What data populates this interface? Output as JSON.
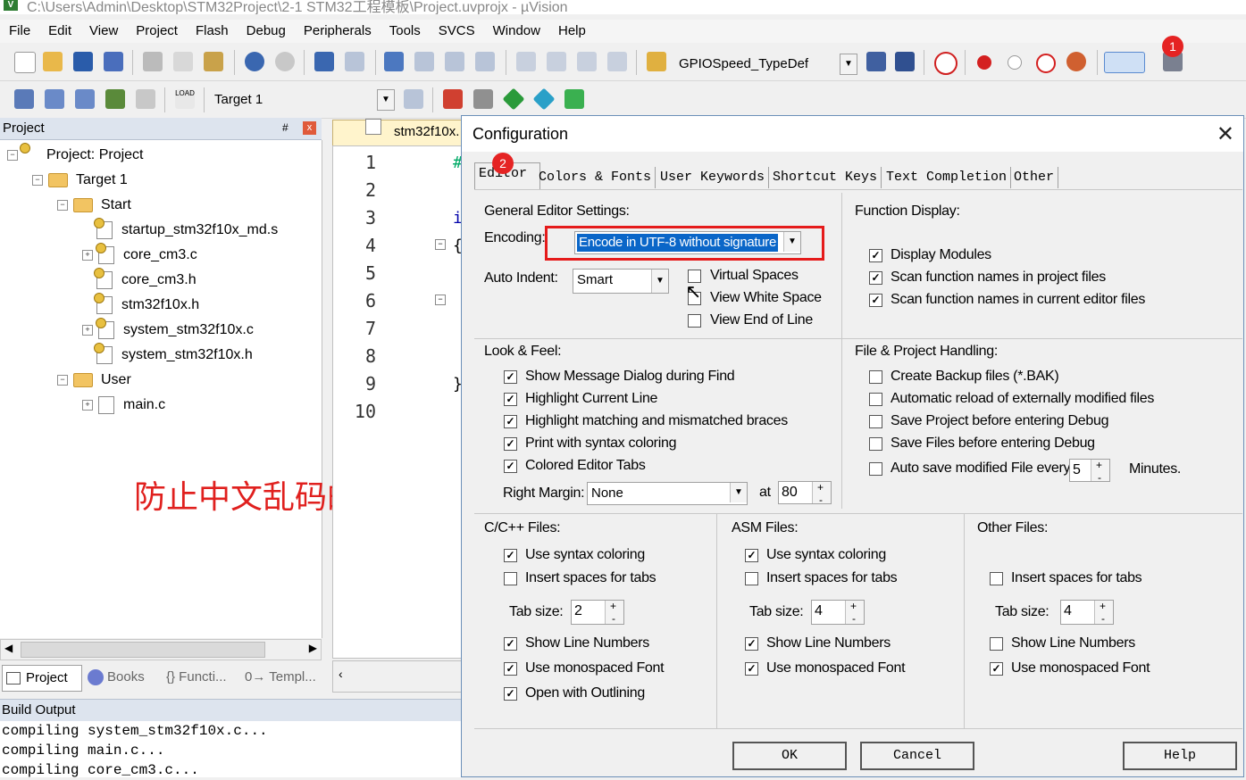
{
  "window": {
    "title": "C:\\Users\\Admin\\Desktop\\STM32Project\\2-1 STM32工程模板\\Project.uvprojx - µVision"
  },
  "menu": [
    "File",
    "Edit",
    "View",
    "Project",
    "Flash",
    "Debug",
    "Peripherals",
    "Tools",
    "SVCS",
    "Window",
    "Help"
  ],
  "toolbar1": {
    "symbol_combo": "GPIOSpeed_TypeDef"
  },
  "toolbar2": {
    "target_combo": "Target 1",
    "load_label": "LOAD"
  },
  "project_panel": {
    "title": "Project",
    "pin": "#",
    "close": "x",
    "tree": [
      {
        "label": "Project: Project"
      },
      {
        "label": "Target 1"
      },
      {
        "label": "Start"
      },
      {
        "label": "startup_stm32f10x_md.s"
      },
      {
        "label": "core_cm3.c"
      },
      {
        "label": "core_cm3.h"
      },
      {
        "label": "stm32f10x.h"
      },
      {
        "label": "system_stm32f10x.c"
      },
      {
        "label": "system_stm32f10x.h"
      },
      {
        "label": "User"
      },
      {
        "label": "main.c"
      }
    ],
    "tabs": [
      "Project",
      "Books",
      "{} Functi...",
      "0→ Templ..."
    ]
  },
  "editor": {
    "tab": "stm32f10x.",
    "line_numbers": [
      "1",
      "2",
      "3",
      "4",
      "5",
      "6",
      "7",
      "8",
      "9",
      "10"
    ],
    "code_chars": {
      "l1": "#",
      "l3": "i",
      "l4": "{",
      "l9": "}"
    }
  },
  "annotation": {
    "text": "防止中文乱码的问题"
  },
  "build_output": {
    "title": "Build Output",
    "lines": [
      "compiling system_stm32f10x.c...",
      "compiling main.c...",
      "compiling core_cm3.c..."
    ]
  },
  "dialog": {
    "title": "Configuration",
    "close": "✕",
    "tabs": [
      "Editor",
      "Colors & Fonts",
      "User Keywords",
      "Shortcut Keys",
      "Text Completion",
      "Other"
    ],
    "general": {
      "heading": "General Editor Settings:",
      "encoding_label": "Encoding:",
      "encoding_value": "Encode in UTF-8 without signature",
      "auto_indent_label": "Auto Indent:",
      "auto_indent_value": "Smart",
      "virtual_spaces": "Virtual Spaces",
      "view_white_space": "View White Space",
      "view_end_of_line": "View End of Line"
    },
    "function_display": {
      "heading": "Function Display:",
      "items": [
        "Display Modules",
        "Scan function names in project files",
        "Scan function names in current editor files"
      ]
    },
    "look_feel": {
      "heading": "Look & Feel:",
      "items": [
        "Show Message Dialog during Find",
        "Highlight Current Line",
        "Highlight matching and mismatched braces",
        "Print with syntax coloring",
        "Colored Editor Tabs"
      ],
      "right_margin_label": "Right Margin:",
      "right_margin_value": "None",
      "at_label": "at",
      "at_value": "80"
    },
    "file_project": {
      "heading": "File & Project Handling:",
      "items": [
        "Create Backup files (*.BAK)",
        "Automatic reload of externally modified files",
        "Save Project before entering Debug",
        "Save Files before entering Debug",
        "Auto save modified File every"
      ],
      "autosave_value": "5",
      "minutes_label": "Minutes."
    },
    "c_files": {
      "heading": "C/C++ Files:",
      "use_syntax": "Use syntax coloring",
      "insert_spaces": "Insert spaces for tabs",
      "tab_size_label": "Tab size:",
      "tab_size": "2",
      "show_line_numbers": "Show Line Numbers",
      "monospaced": "Use monospaced Font",
      "outlining": "Open with Outlining"
    },
    "asm_files": {
      "heading": "ASM Files:",
      "use_syntax": "Use syntax coloring",
      "insert_spaces": "Insert spaces for tabs",
      "tab_size_label": "Tab size:",
      "tab_size": "4",
      "show_line_numbers": "Show Line Numbers",
      "monospaced": "Use monospaced Font"
    },
    "other_files": {
      "heading": "Other Files:",
      "insert_spaces": "Insert spaces for tabs",
      "tab_size_label": "Tab size:",
      "tab_size": "4",
      "show_line_numbers": "Show Line Numbers",
      "monospaced": "Use monospaced Font"
    },
    "buttons": {
      "ok": "OK",
      "cancel": "Cancel",
      "help": "Help"
    }
  },
  "badges": {
    "one": "1",
    "two": "2"
  },
  "checkmark": "✓",
  "colors": {
    "highlight_red": "#e51b1b",
    "selection_blue": "#0a66c8",
    "annotation_red": "#e0201e"
  }
}
